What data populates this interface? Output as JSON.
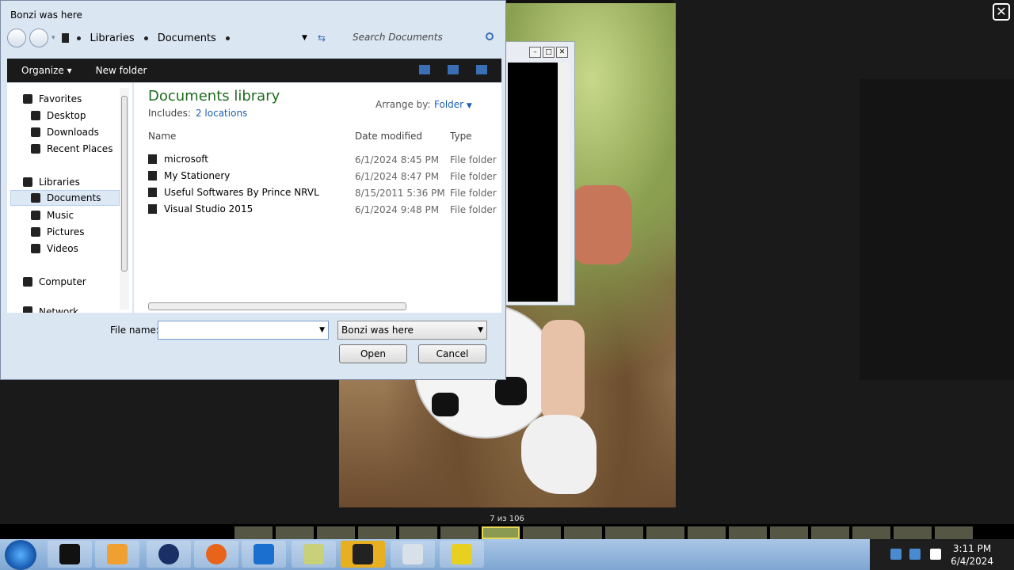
{
  "dialog": {
    "title": "Bonzi was here",
    "breadcrumb": [
      "Libraries",
      "Documents"
    ],
    "search_placeholder": "Search Documents",
    "toolbar": {
      "organize": "Organize",
      "new_folder": "New folder"
    },
    "nav": {
      "favorites": "Favorites",
      "desktop": "Desktop",
      "downloads": "Downloads",
      "recent_places": "Recent Places",
      "libraries": "Libraries",
      "documents": "Documents",
      "music": "Music",
      "pictures": "Pictures",
      "videos": "Videos",
      "computer": "Computer",
      "network": "Network"
    },
    "library": {
      "title": "Documents library",
      "includes_label": "Includes:",
      "includes_value": "2 locations",
      "arrange_label": "Arrange by:",
      "arrange_value": "Folder"
    },
    "columns": {
      "name": "Name",
      "date": "Date modified",
      "type": "Type"
    },
    "files": [
      {
        "name": "microsoft",
        "date": "6/1/2024 8:45 PM",
        "type": "File folder"
      },
      {
        "name": "My Stationery",
        "date": "6/1/2024 8:47 PM",
        "type": "File folder"
      },
      {
        "name": "Useful Softwares By Prince NRVL",
        "date": "8/15/2011 5:36 PM",
        "type": "File folder"
      },
      {
        "name": "Visual Studio 2015",
        "date": "6/1/2024 9:48 PM",
        "type": "File folder"
      }
    ],
    "file_name_label": "File name:",
    "file_name_value": "",
    "filter_value": "Bonzi was here",
    "open_label": "Open",
    "cancel_label": "Cancel"
  },
  "viewer": {
    "counter": "7 из 106"
  },
  "taskbar": {
    "time": "3:11 PM",
    "date": "6/4/2024"
  }
}
